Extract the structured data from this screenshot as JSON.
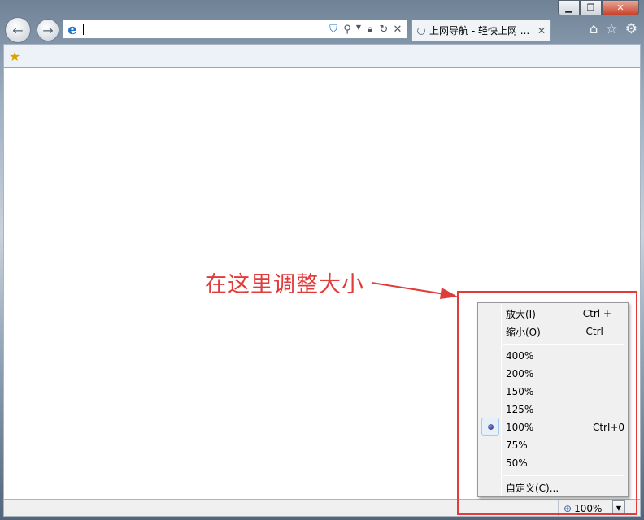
{
  "window": {
    "minimize_icon": "minimize-icon",
    "maximize_icon": "maximize-icon",
    "close_icon": "close-icon"
  },
  "navigation": {
    "address_value": "",
    "tab": {
      "title": "上网导航 - 轻快上网 ...",
      "close": "✕"
    }
  },
  "annotation": {
    "text": "在这里调整大小",
    "color": "#e03c3c"
  },
  "zoom_menu": {
    "zoom_in": {
      "label": "放大(I)",
      "shortcut": "Ctrl +"
    },
    "zoom_out": {
      "label": "缩小(O)",
      "shortcut": "Ctrl -"
    },
    "levels": [
      {
        "label": "400%",
        "shortcut": ""
      },
      {
        "label": "200%",
        "shortcut": ""
      },
      {
        "label": "150%",
        "shortcut": ""
      },
      {
        "label": "125%",
        "shortcut": ""
      },
      {
        "label": "100%",
        "shortcut": "Ctrl+0",
        "selected": true
      },
      {
        "label": "75%",
        "shortcut": ""
      },
      {
        "label": "50%",
        "shortcut": ""
      }
    ],
    "custom": {
      "label": "自定义(C)..."
    }
  },
  "status_bar": {
    "zoom_level": "100%"
  }
}
